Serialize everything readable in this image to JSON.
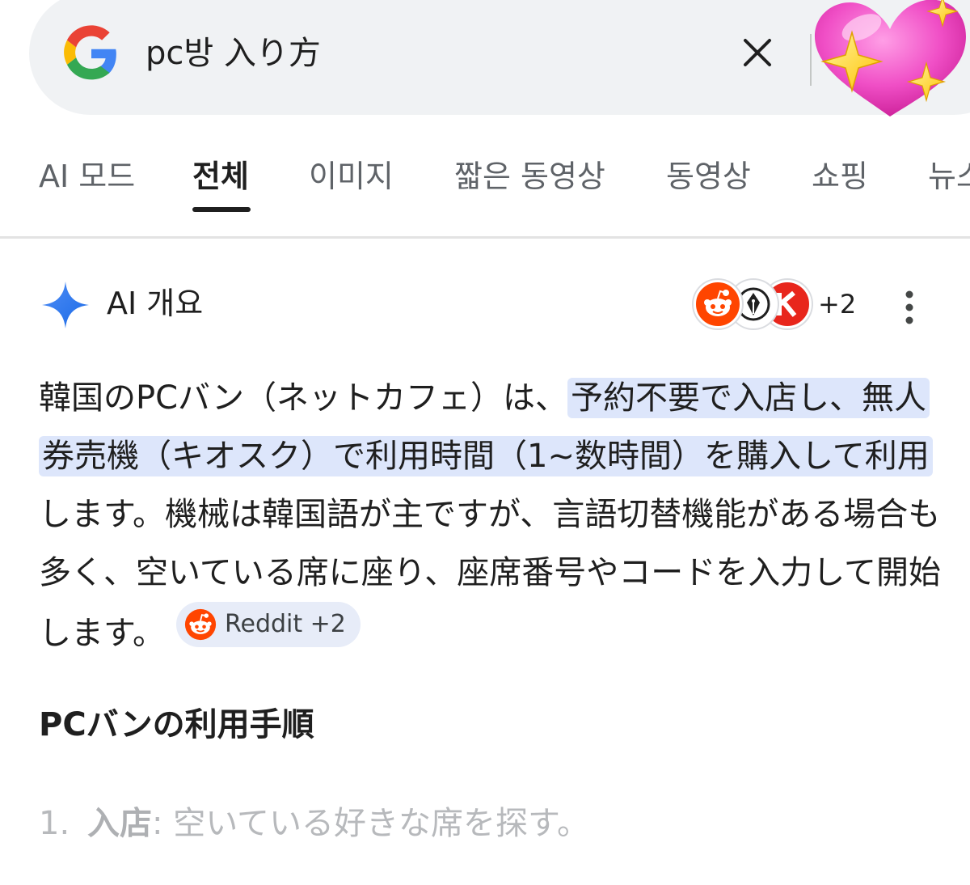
{
  "search": {
    "query": "pc방 入り方",
    "clear_icon": "close-icon",
    "logo_icon": "google-g-logo"
  },
  "sticker": {
    "icon": "sparkling-heart-emoji"
  },
  "tabs": [
    {
      "label": "AI 모드"
    },
    {
      "label": "전체",
      "active": true
    },
    {
      "label": "이미지"
    },
    {
      "label": "짧은 동영상"
    },
    {
      "label": "동영상"
    },
    {
      "label": "쇼핑"
    },
    {
      "label": "뉴스"
    }
  ],
  "ai_overview": {
    "title": "AI 개요",
    "spark_icon": "gemini-spark-icon",
    "sources_extra": "+2",
    "source_icons": [
      "reddit-icon",
      "fountain-pen-icon",
      "k-icon"
    ],
    "more_icon": "more-vert-icon",
    "paragraph": {
      "part1": "韓国のPCバン（ネットカフェ）は、",
      "highlight": "予約不要で入店し、無人券売機（キオスク）で利用時間（1~数時間）を購入して利用",
      "part2": "します。機械は韓国語が主ですが、言語切替機能がある場合も多く、空いている席に座り、座席番号やコードを入力して開始します。"
    },
    "chip_label": "Reddit +2",
    "chip_icon": "reddit-icon"
  },
  "section": {
    "title": "PCバンの利用手順",
    "items": [
      {
        "number": "1.",
        "term": "入店",
        "text": ": 空いている好きな席を探す。"
      }
    ]
  },
  "colors": {
    "highlight": "#dde6fb",
    "reddit": "#ff4500",
    "search_bg": "#f0f2f4"
  }
}
